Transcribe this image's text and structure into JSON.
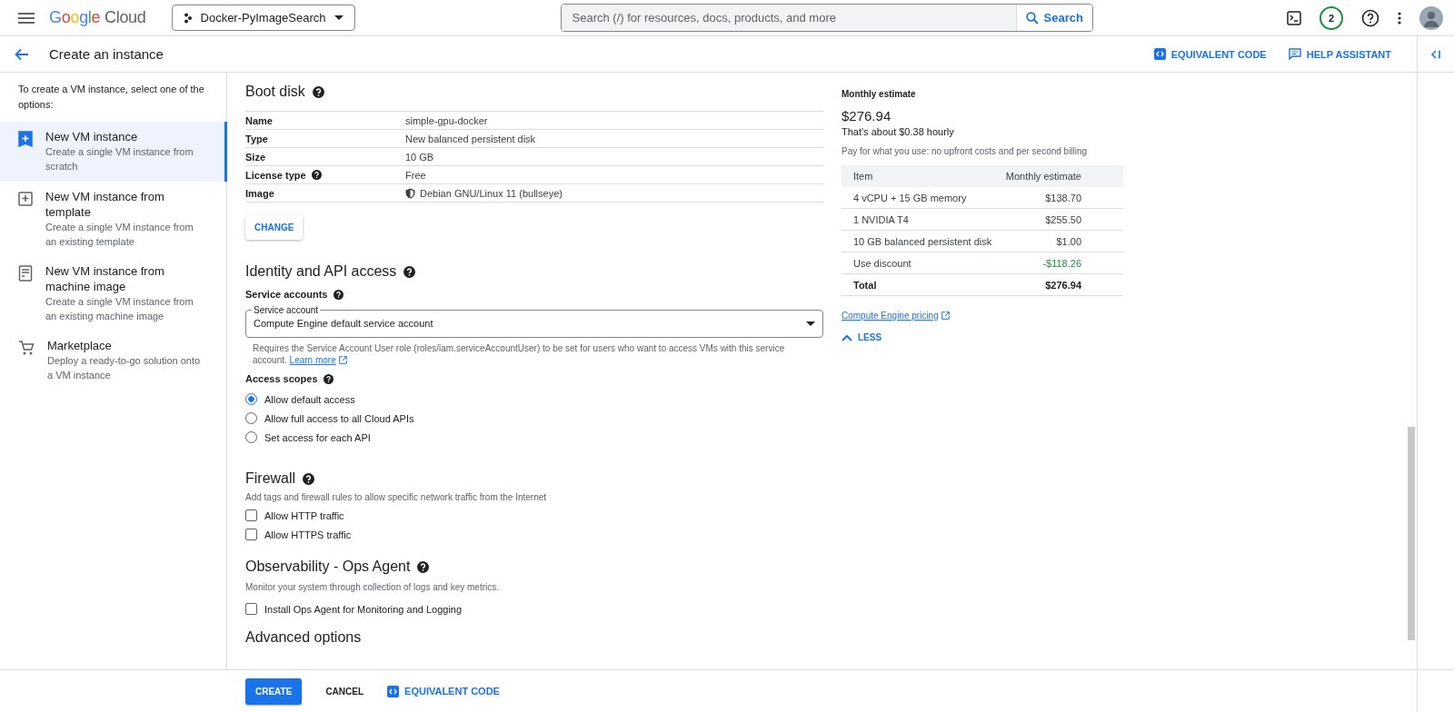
{
  "header": {
    "brand": "Google Cloud",
    "project": "Docker-PyImageSearch",
    "search_placeholder": "Search (/) for resources, docs, products, and more",
    "search_button": "Search",
    "notification_count": "2"
  },
  "subheader": {
    "title": "Create an instance",
    "actions": [
      "EQUIVALENT CODE",
      "HELP ASSISTANT"
    ]
  },
  "sidebar": {
    "intro": "To create a VM instance, select one of the options:",
    "items": [
      {
        "title": "New VM instance",
        "description": "Create a single VM instance from scratch",
        "selected": true
      },
      {
        "title": "New VM instance from template",
        "description": "Create a single VM instance from an existing template",
        "selected": false
      },
      {
        "title": "New VM instance from machine image",
        "description": "Create a single VM instance from an existing machine image",
        "selected": false
      },
      {
        "title": "Marketplace",
        "description": "Deploy a ready-to-go solution onto a VM instance",
        "selected": false
      }
    ]
  },
  "boot_disk": {
    "title": "Boot disk",
    "rows": [
      {
        "label": "Name",
        "value": "simple-gpu-docker",
        "kind": "plain"
      },
      {
        "label": "Type",
        "value": "New balanced persistent disk",
        "kind": "plain"
      },
      {
        "label": "Size",
        "value": "10 GB",
        "kind": "plain"
      },
      {
        "label": "License type",
        "value": "Free",
        "kind": "help"
      },
      {
        "label": "Image",
        "value": "Debian GNU/Linux 11 (bullseye)",
        "kind": "image"
      }
    ],
    "change_button": "CHANGE"
  },
  "identity": {
    "title": "Identity and API access",
    "service_accounts_label": "Service accounts",
    "field_label": "Service account",
    "field_value": "Compute Engine default service account",
    "note": "Requires the Service Account User role (roles/iam.serviceAccountUser) to be set for users who want to access VMs with this service account.",
    "learn_more": "Learn more",
    "access_scopes_label": "Access scopes",
    "scopes": [
      {
        "label": "Allow default access",
        "selected": true
      },
      {
        "label": "Allow full access to all Cloud APIs",
        "selected": false
      },
      {
        "label": "Set access for each API",
        "selected": false
      }
    ]
  },
  "firewall": {
    "title": "Firewall",
    "description": "Add tags and firewall rules to allow specific network traffic from the Internet",
    "options": [
      {
        "label": "Allow HTTP traffic",
        "checked": false
      },
      {
        "label": "Allow HTTPS traffic",
        "checked": false
      }
    ]
  },
  "observability": {
    "title": "Observability - Ops Agent",
    "description": "Monitor your system through collection of logs and key metrics.",
    "options": [
      {
        "label": "Install Ops Agent for Monitoring and Logging",
        "checked": false
      }
    ]
  },
  "advanced": {
    "title": "Advanced options"
  },
  "estimate": {
    "label": "Monthly estimate",
    "total": "$276.94",
    "hourly": "That's about $0.38 hourly",
    "note": "Pay for what you use: no upfront costs and per second billing",
    "columns": [
      "Item",
      "Monthly estimate"
    ],
    "rows": [
      {
        "item": "4 vCPU + 15 GB memory",
        "cost": "$138.70",
        "kind": "line"
      },
      {
        "item": "1 NVIDIA T4",
        "cost": "$255.50",
        "kind": "line"
      },
      {
        "item": "10 GB balanced persistent disk",
        "cost": "$1.00",
        "kind": "line"
      },
      {
        "item": "Use discount",
        "cost": "-$118.26",
        "kind": "discount"
      },
      {
        "item": "Total",
        "cost": "$276.94",
        "kind": "total"
      }
    ],
    "pricing_link": "Compute Engine pricing",
    "less": "LESS"
  },
  "footer": {
    "create": "CREATE",
    "cancel": "CANCEL",
    "equivalent_code": "EQUIVALENT CODE"
  }
}
